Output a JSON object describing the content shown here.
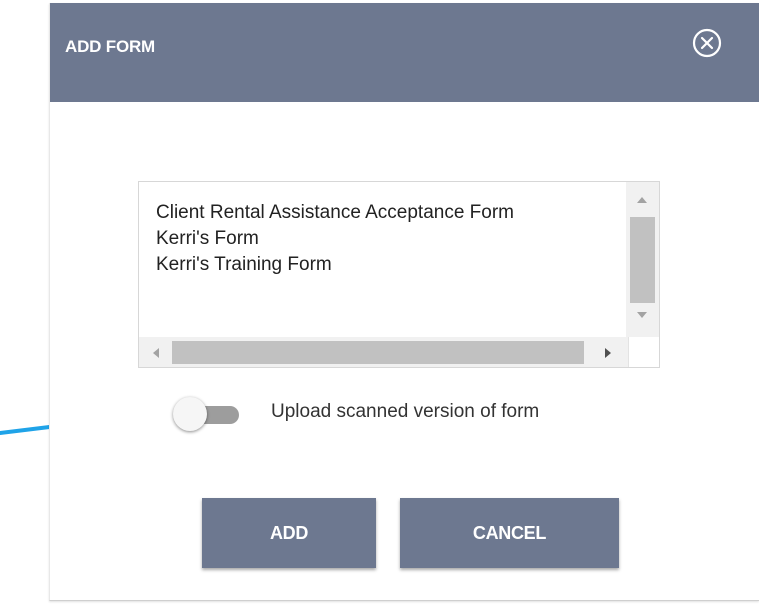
{
  "dialog": {
    "title": "ADD FORM",
    "close_icon": "close-circle-icon",
    "header_color": "#6d7890"
  },
  "form_list": {
    "items": [
      "Client Rental Assistance Acceptance Form",
      "Kerri's Form",
      "Kerri's Training Form"
    ],
    "scroll_icons": {
      "up": "arrow-up-icon",
      "down": "arrow-down-icon",
      "left": "arrow-left-icon",
      "right": "arrow-right-icon"
    }
  },
  "upload_toggle": {
    "label": "Upload scanned version of form",
    "enabled": false
  },
  "buttons": {
    "add_label": "ADD",
    "cancel_label": "CANCEL",
    "color": "#6d7890"
  },
  "annotation": {
    "arrow_icon": "callout-arrow-icon",
    "color": "#1fa3e8"
  }
}
